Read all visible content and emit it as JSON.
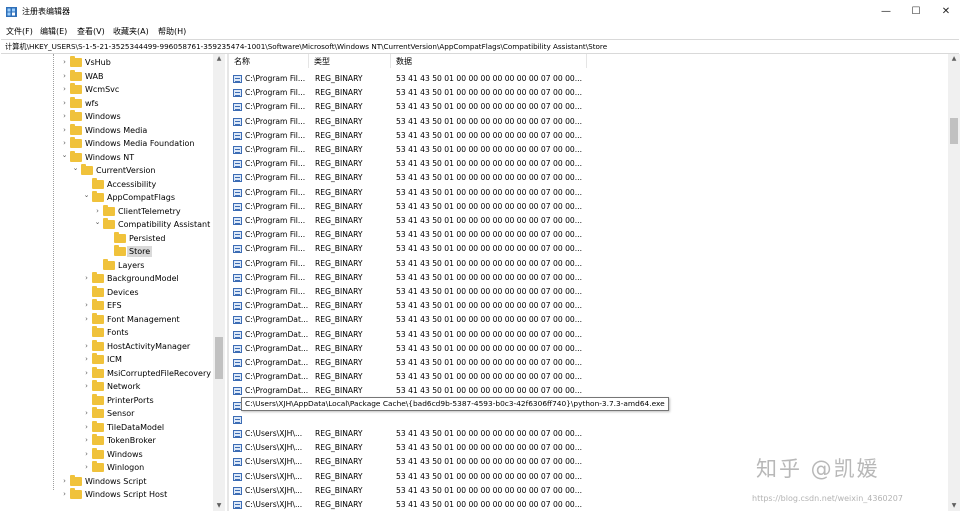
{
  "window": {
    "title": "注册表编辑器",
    "minimize_label": "—",
    "maximize_label": "☐",
    "close_label": "✕"
  },
  "menu": [
    {
      "label": "文件(F)"
    },
    {
      "label": "编辑(E)"
    },
    {
      "label": "查看(V)"
    },
    {
      "label": "收藏夹(A)"
    },
    {
      "label": "帮助(H)"
    }
  ],
  "address": {
    "path": "计算机\\HKEY_USERS\\S-1-5-21-3525344499-996058761-359235474-1001\\Software\\Microsoft\\Windows NT\\CurrentVersion\\AppCompatFlags\\Compatibility Assistant\\Store"
  },
  "tree": [
    {
      "label": "VsHub",
      "level": 0,
      "chevron": "collapsed"
    },
    {
      "label": "WAB",
      "level": 0,
      "chevron": "collapsed"
    },
    {
      "label": "WcmSvc",
      "level": 0,
      "chevron": "collapsed"
    },
    {
      "label": "wfs",
      "level": 0,
      "chevron": "collapsed"
    },
    {
      "label": "Windows",
      "level": 0,
      "chevron": "collapsed"
    },
    {
      "label": "Windows Media",
      "level": 0,
      "chevron": "collapsed"
    },
    {
      "label": "Windows Media Foundation",
      "level": 0,
      "chevron": "collapsed"
    },
    {
      "label": "Windows NT",
      "level": 0,
      "chevron": "expanded"
    },
    {
      "label": "CurrentVersion",
      "level": 1,
      "chevron": "expanded"
    },
    {
      "label": "Accessibility",
      "level": 2,
      "chevron": "none"
    },
    {
      "label": "AppCompatFlags",
      "level": 2,
      "chevron": "expanded"
    },
    {
      "label": "ClientTelemetry",
      "level": 3,
      "chevron": "collapsed"
    },
    {
      "label": "Compatibility Assistant",
      "level": 3,
      "chevron": "expanded"
    },
    {
      "label": "Persisted",
      "level": 4,
      "chevron": "none"
    },
    {
      "label": "Store",
      "level": 4,
      "chevron": "none",
      "selected": true
    },
    {
      "label": "Layers",
      "level": 3,
      "chevron": "none"
    },
    {
      "label": "BackgroundModel",
      "level": 2,
      "chevron": "collapsed"
    },
    {
      "label": "Devices",
      "level": 2,
      "chevron": "none"
    },
    {
      "label": "EFS",
      "level": 2,
      "chevron": "collapsed"
    },
    {
      "label": "Font Management",
      "level": 2,
      "chevron": "collapsed"
    },
    {
      "label": "Fonts",
      "level": 2,
      "chevron": "none"
    },
    {
      "label": "HostActivityManager",
      "level": 2,
      "chevron": "collapsed"
    },
    {
      "label": "ICM",
      "level": 2,
      "chevron": "collapsed"
    },
    {
      "label": "MsiCorruptedFileRecovery",
      "level": 2,
      "chevron": "collapsed"
    },
    {
      "label": "Network",
      "level": 2,
      "chevron": "collapsed"
    },
    {
      "label": "PrinterPorts",
      "level": 2,
      "chevron": "none"
    },
    {
      "label": "Sensor",
      "level": 2,
      "chevron": "collapsed"
    },
    {
      "label": "TileDataModel",
      "level": 2,
      "chevron": "collapsed"
    },
    {
      "label": "TokenBroker",
      "level": 2,
      "chevron": "collapsed"
    },
    {
      "label": "Windows",
      "level": 2,
      "chevron": "collapsed"
    },
    {
      "label": "Winlogon",
      "level": 2,
      "chevron": "collapsed"
    },
    {
      "label": "Windows Script",
      "level": 0,
      "chevron": "collapsed"
    },
    {
      "label": "Windows Script Host",
      "level": 0,
      "chevron": "collapsed"
    }
  ],
  "list": {
    "columns": {
      "name": "名称",
      "type": "类型",
      "data": "数据"
    },
    "rows": [
      {
        "name": "C:\\Program Fil...",
        "type": "REG_BINARY",
        "data": "53 41 43 50 01 00 00 00 00 00 00 00 07 00 00..."
      },
      {
        "name": "C:\\Program Fil...",
        "type": "REG_BINARY",
        "data": "53 41 43 50 01 00 00 00 00 00 00 00 07 00 00..."
      },
      {
        "name": "C:\\Program Fil...",
        "type": "REG_BINARY",
        "data": "53 41 43 50 01 00 00 00 00 00 00 00 07 00 00..."
      },
      {
        "name": "C:\\Program Fil...",
        "type": "REG_BINARY",
        "data": "53 41 43 50 01 00 00 00 00 00 00 00 07 00 00..."
      },
      {
        "name": "C:\\Program Fil...",
        "type": "REG_BINARY",
        "data": "53 41 43 50 01 00 00 00 00 00 00 00 07 00 00..."
      },
      {
        "name": "C:\\Program Fil...",
        "type": "REG_BINARY",
        "data": "53 41 43 50 01 00 00 00 00 00 00 00 07 00 00..."
      },
      {
        "name": "C:\\Program Fil...",
        "type": "REG_BINARY",
        "data": "53 41 43 50 01 00 00 00 00 00 00 00 07 00 00..."
      },
      {
        "name": "C:\\Program Fil...",
        "type": "REG_BINARY",
        "data": "53 41 43 50 01 00 00 00 00 00 00 00 07 00 00..."
      },
      {
        "name": "C:\\Program Fil...",
        "type": "REG_BINARY",
        "data": "53 41 43 50 01 00 00 00 00 00 00 00 07 00 00..."
      },
      {
        "name": "C:\\Program Fil...",
        "type": "REG_BINARY",
        "data": "53 41 43 50 01 00 00 00 00 00 00 00 07 00 00..."
      },
      {
        "name": "C:\\Program Fil...",
        "type": "REG_BINARY",
        "data": "53 41 43 50 01 00 00 00 00 00 00 00 07 00 00..."
      },
      {
        "name": "C:\\Program Fil...",
        "type": "REG_BINARY",
        "data": "53 41 43 50 01 00 00 00 00 00 00 00 07 00 00..."
      },
      {
        "name": "C:\\Program Fil...",
        "type": "REG_BINARY",
        "data": "53 41 43 50 01 00 00 00 00 00 00 00 07 00 00..."
      },
      {
        "name": "C:\\Program Fil...",
        "type": "REG_BINARY",
        "data": "53 41 43 50 01 00 00 00 00 00 00 00 07 00 00..."
      },
      {
        "name": "C:\\Program Fil...",
        "type": "REG_BINARY",
        "data": "53 41 43 50 01 00 00 00 00 00 00 00 07 00 00..."
      },
      {
        "name": "C:\\Program Fil...",
        "type": "REG_BINARY",
        "data": "53 41 43 50 01 00 00 00 00 00 00 00 07 00 00..."
      },
      {
        "name": "C:\\ProgramDat...",
        "type": "REG_BINARY",
        "data": "53 41 43 50 01 00 00 00 00 00 00 00 07 00 00..."
      },
      {
        "name": "C:\\ProgramDat...",
        "type": "REG_BINARY",
        "data": "53 41 43 50 01 00 00 00 00 00 00 00 07 00 00..."
      },
      {
        "name": "C:\\ProgramDat...",
        "type": "REG_BINARY",
        "data": "53 41 43 50 01 00 00 00 00 00 00 00 07 00 00..."
      },
      {
        "name": "C:\\ProgramDat...",
        "type": "REG_BINARY",
        "data": "53 41 43 50 01 00 00 00 00 00 00 00 07 00 00..."
      },
      {
        "name": "C:\\ProgramDat...",
        "type": "REG_BINARY",
        "data": "53 41 43 50 01 00 00 00 00 00 00 00 07 00 00..."
      },
      {
        "name": "C:\\ProgramDat...",
        "type": "REG_BINARY",
        "data": "53 41 43 50 01 00 00 00 00 00 00 00 07 00 00..."
      },
      {
        "name": "C:\\ProgramDat...",
        "type": "REG_BINARY",
        "data": "53 41 43 50 01 00 00 00 00 00 00 00 07 00 00..."
      },
      {
        "name": "C:\\Users\\Publi...",
        "type": "REG_BINARY",
        "data": "53 41 43 50 01 00 00 00 00 00 00 00 07 00 00..."
      },
      {
        "name": "",
        "type": "",
        "data": ""
      },
      {
        "name": "C:\\Users\\XJH\\...",
        "type": "REG_BINARY",
        "data": "53 41 43 50 01 00 00 00 00 00 00 00 07 00 00..."
      },
      {
        "name": "C:\\Users\\XJH\\...",
        "type": "REG_BINARY",
        "data": "53 41 43 50 01 00 00 00 00 00 00 00 07 00 00..."
      },
      {
        "name": "C:\\Users\\XJH\\...",
        "type": "REG_BINARY",
        "data": "53 41 43 50 01 00 00 00 00 00 00 00 07 00 00..."
      },
      {
        "name": "C:\\Users\\XJH\\...",
        "type": "REG_BINARY",
        "data": "53 41 43 50 01 00 00 00 00 00 00 00 07 00 00..."
      },
      {
        "name": "C:\\Users\\XJH\\...",
        "type": "REG_BINARY",
        "data": "53 41 43 50 01 00 00 00 00 00 00 00 07 00 00..."
      },
      {
        "name": "C:\\Users\\XJH\\...",
        "type": "REG_BINARY",
        "data": "53 41 43 50 01 00 00 00 00 00 00 00 07 00 00..."
      },
      {
        "name": "C:\\Users\\XJH\\...",
        "type": "REG_BINARY",
        "data": "53 41 43 50 01 00 00 00 00 00 00 00 07 00 00..."
      }
    ]
  },
  "tooltip": {
    "text": "C:\\Users\\XJH\\AppData\\Local\\Package Cache\\{bad6cd9b-5387-4593-b0c3-42f6306ff740}\\python-3.7.3-amd64.exe"
  },
  "watermark": {
    "main": "知乎 @凯媛",
    "url": "https://blog.csdn.net/weixin_4360207"
  }
}
